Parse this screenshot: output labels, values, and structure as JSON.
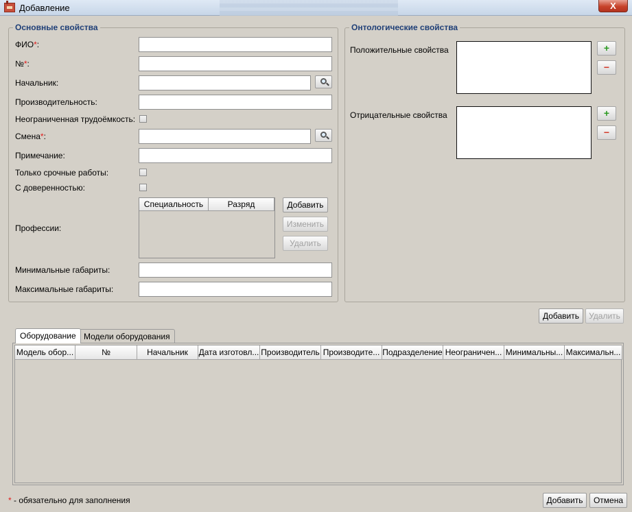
{
  "window": {
    "title": "Добавление",
    "close_label": "X"
  },
  "main_props": {
    "legend": "Основные свойства",
    "fio_label": "ФИО",
    "number_label": "№",
    "required_mark": "*",
    "colon": ":",
    "chief_label": "Начальник:",
    "productivity_label": "Производительность:",
    "unlimited_label": "Неограниченная трудоёмкость:",
    "shift_label": "Смена",
    "note_label": "Примечание:",
    "urgent_label": "Только срочные работы:",
    "proxy_label": "С доверенностью:",
    "professions_label": "Профессии:",
    "professions_columns": [
      "Специальность",
      "Разряд"
    ],
    "add_button": "Добавить",
    "edit_button": "Изменить",
    "delete_button": "Удалить",
    "min_dims_label": "Минимальные габариты:",
    "max_dims_label": "Максимальные габариты:"
  },
  "onto_props": {
    "legend": "Онтологические свойства",
    "positive_label": "Положительные свойства",
    "negative_label": "Отрицательные свойства",
    "plus_glyph": "+",
    "minus_glyph": "−"
  },
  "equipment_buttons": {
    "add": "Добавить",
    "delete": "Удалить"
  },
  "tabs": [
    {
      "label": "Оборудование",
      "active": true
    },
    {
      "label": "Модели оборудования",
      "active": false
    }
  ],
  "equipment_table": {
    "columns": [
      "Модель обор...",
      "№",
      "Начальник",
      "Дата изготовл...",
      "Производитель",
      "Производите...",
      "Подразделение",
      "Неограничен...",
      "Минимальны...",
      "Максимальн..."
    ]
  },
  "footer": {
    "required_note": "- обязательно для заполнения",
    "required_mark": "*",
    "add_button": "Добавить",
    "cancel_button": "Отмена"
  }
}
